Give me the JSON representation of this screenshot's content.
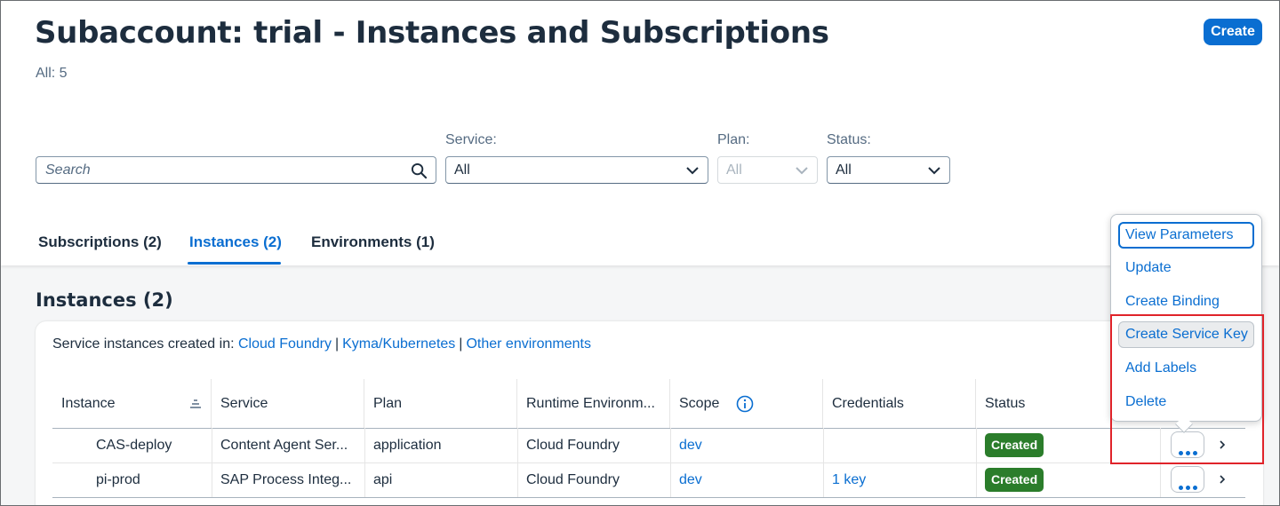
{
  "header": {
    "title": "Subaccount: trial - Instances and Subscriptions",
    "count": "All: 5",
    "create_label": "Create"
  },
  "filters": {
    "search_placeholder": "Search",
    "service_label": "Service:",
    "service_value": "All",
    "plan_label": "Plan:",
    "plan_value": "All",
    "status_label": "Status:",
    "status_value": "All"
  },
  "tabs": [
    {
      "label": "Subscriptions (2)",
      "active": false
    },
    {
      "label": "Instances (2)",
      "active": true
    },
    {
      "label": "Environments (1)",
      "active": false
    }
  ],
  "section": {
    "title": "Instances (2)",
    "info_prefix": "Service instances created in:",
    "links": [
      "Cloud Foundry",
      "Kyma/Kubernetes",
      "Other environments"
    ],
    "separator": "|"
  },
  "table": {
    "columns": [
      "Instance",
      "Service",
      "Plan",
      "Runtime Environm...",
      "Scope",
      "Credentials",
      "Status"
    ],
    "rows": [
      {
        "instance": "CAS-deploy",
        "service": "Content Agent Ser...",
        "plan": "application",
        "runtime": "Cloud Foundry",
        "scope": "dev",
        "credentials": "",
        "status": "Created"
      },
      {
        "instance": "pi-prod",
        "service": "SAP Process Integ...",
        "plan": "api",
        "runtime": "Cloud Foundry",
        "scope": "dev",
        "credentials": "1 key",
        "status": "Created"
      }
    ]
  },
  "menu": {
    "items": [
      "View Parameters",
      "Update",
      "Create Binding",
      "Create Service Key",
      "Add Labels",
      "Delete"
    ]
  },
  "colors": {
    "accent": "#0a6ed1",
    "status_success": "#2b7d2b",
    "highlight": "#e0232a"
  }
}
